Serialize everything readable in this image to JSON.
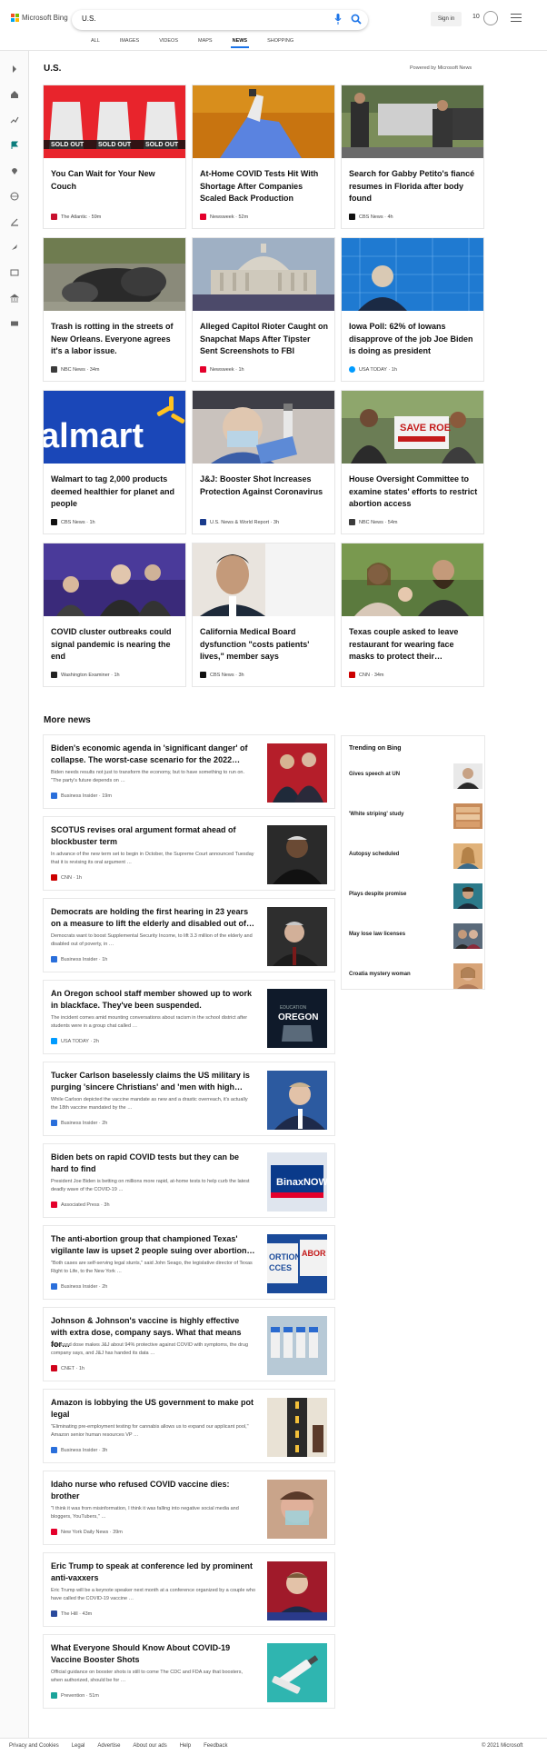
{
  "header": {
    "logo_text": "Microsoft Bing",
    "search_value": "U.S.",
    "signin_label": "Sign in",
    "rewards_count": "10",
    "tabs": [
      "ALL",
      "IMAGES",
      "VIDEOS",
      "MAPS",
      "NEWS",
      "SHOPPING"
    ],
    "active_tab": "NEWS"
  },
  "section": {
    "title": "U.S.",
    "powered_by": "Powered by Microsoft News"
  },
  "cards": [
    {
      "title": "You Can Wait for Your New Couch",
      "source": "The Atlantic",
      "time": "59m",
      "fav": "#c8102e"
    },
    {
      "title": "At-Home COVID Tests Hit With Shortage After Companies Scaled Back Production",
      "source": "Newsweek",
      "time": "52m",
      "fav": "#e4002b"
    },
    {
      "title": "Search for Gabby Petito's fiancé resumes in Florida after body found",
      "source": "CBS News",
      "time": "4h",
      "fav": "#111111"
    },
    {
      "title": "Trash is rotting in the streets of New Orleans. Everyone agrees it's a labor issue.",
      "source": "NBC News",
      "time": "34m",
      "fav": "#3b3b3b"
    },
    {
      "title": "Alleged Capitol Rioter Caught on Snapchat Maps After Tipster Sent Screenshots to FBI",
      "source": "Newsweek",
      "time": "1h",
      "fav": "#e4002b"
    },
    {
      "title": "Iowa Poll: 62% of Iowans disapprove of the job Joe Biden is doing as president",
      "source": "USA TODAY",
      "time": "1h",
      "fav": "#009bff"
    },
    {
      "title": "Walmart to tag 2,000 products deemed healthier for planet and people",
      "source": "CBS News",
      "time": "1h",
      "fav": "#111111"
    },
    {
      "title": "J&J: Booster Shot Increases Protection Against Coronavirus",
      "source": "U.S. News & World Report",
      "time": "3h",
      "fav": "#1a3b8c"
    },
    {
      "title": "House Oversight Committee to examine states' efforts to restrict abortion access",
      "source": "NBC News",
      "time": "54m",
      "fav": "#3b3b3b"
    },
    {
      "title": "COVID cluster outbreaks could signal pandemic is nearing the end",
      "source": "Washington Examiner",
      "time": "1h",
      "fav": "#222222"
    },
    {
      "title": "California Medical Board dysfunction \"costs patients' lives,\" member says",
      "source": "CBS News",
      "time": "3h",
      "fav": "#111111"
    },
    {
      "title": "Texas couple asked to leave restaurant for wearing face masks to protect their…",
      "source": "CNN",
      "time": "34m",
      "fav": "#cc0000"
    }
  ],
  "more_news_title": "More news",
  "news": [
    {
      "title": "Biden's economic agenda in 'significant danger' of collapse. The worst-case scenario for the 2022…",
      "desc": "Biden needs results not just to transform the economy, but to have something to run on. \"The party's future depends on …",
      "source": "Business Insider",
      "time": "19m",
      "fav": "#2a6fdb"
    },
    {
      "title": "SCOTUS revises oral argument format ahead of blockbuster term",
      "desc": "In advance of the new term set to begin in October, the Supreme Court announced Tuesday that it is revising its oral argument …",
      "source": "CNN",
      "time": "1h",
      "fav": "#cc0000"
    },
    {
      "title": "Democrats are holding the first hearing in 23 years on a measure to lift the elderly and disabled out of…",
      "desc": "Democrats want to boost Supplemental Security Income, to lift 3.3 million of the elderly and disabled out of poverty, in …",
      "source": "Business Insider",
      "time": "1h",
      "fav": "#2a6fdb"
    },
    {
      "title": "An Oregon school staff member showed up to work in blackface. They've been suspended.",
      "desc": "The incident comes amid mounting conversations about racism in the school district after students were in a group chat called …",
      "source": "USA TODAY",
      "time": "2h",
      "fav": "#009bff"
    },
    {
      "title": "Tucker Carlson baselessly claims the US military is purging 'sincere Christians' and 'men with high…",
      "desc": "While Carlson depicted the vaccine mandate as new and a drastic overreach, it's actually the 18th vaccine mandated by the …",
      "source": "Business Insider",
      "time": "2h",
      "fav": "#2a6fdb"
    },
    {
      "title": "Biden bets on rapid COVID tests but they can be hard to find",
      "desc": "President Joe Biden is betting on millions more rapid, at-home tests to help curb the latest deadly wave of the COVID-19 …",
      "source": "Associated Press",
      "time": "3h",
      "fav": "#e4002b"
    },
    {
      "title": "The anti-abortion group that championed Texas' vigilante law is upset 2 people suing over abortion…",
      "desc": "\"Both cases are self-serving legal stunts,\" said John Seago, the legislative director of Texas Right to Life, to the New York …",
      "source": "Business Insider",
      "time": "2h",
      "fav": "#2a6fdb"
    },
    {
      "title": "Johnson & Johnson's vaccine is highly effective with extra dose, company says. What that means for…",
      "desc": "A second dose makes J&J about 94% protective against COVID with symptoms, the drug company says, and J&J has handed its data …",
      "source": "CNET",
      "time": "1h",
      "fav": "#d0021b"
    },
    {
      "title": "Amazon is lobbying the US government to make pot legal",
      "desc": "\"Eliminating pre-employment testing for cannabis allows us to expand our applicant pool,\" Amazon senior human resources VP …",
      "source": "Business Insider",
      "time": "3h",
      "fav": "#2a6fdb"
    },
    {
      "title": "Idaho nurse who refused COVID vaccine dies: brother",
      "desc": "\"I think it was from misinformation, I think it was falling into negative social media and bloggers, YouTubers,\" …",
      "source": "New York Daily News",
      "time": "39m",
      "fav": "#e4002b"
    },
    {
      "title": "Eric Trump to speak at conference led by prominent anti-vaxxers",
      "desc": "Eric Trump will be a keynote speaker next month at a conference organized by a couple who have called the COVID-19 vaccine …",
      "source": "The Hill",
      "time": "43m",
      "fav": "#2a4a9c"
    },
    {
      "title": "What Everyone Should Know About COVID-19 Vaccine Booster Shots",
      "desc": "Official guidance on booster shots is still to come The CDC and FDA say that boosters, when authorized, should be for …",
      "source": "Prevention",
      "time": "51m",
      "fav": "#1aa39a"
    }
  ],
  "trending": {
    "title": "Trending on Bing",
    "items": [
      "Gives speech at UN",
      "'White striping' study",
      "Autopsy scheduled",
      "Plays despite promise",
      "May lose law licenses",
      "Croatia mystery woman"
    ]
  },
  "footer": {
    "links": [
      "Privacy and Cookies",
      "Legal",
      "Advertise",
      "About our ads",
      "Help",
      "Feedback"
    ],
    "copyright": "© 2021 Microsoft"
  }
}
